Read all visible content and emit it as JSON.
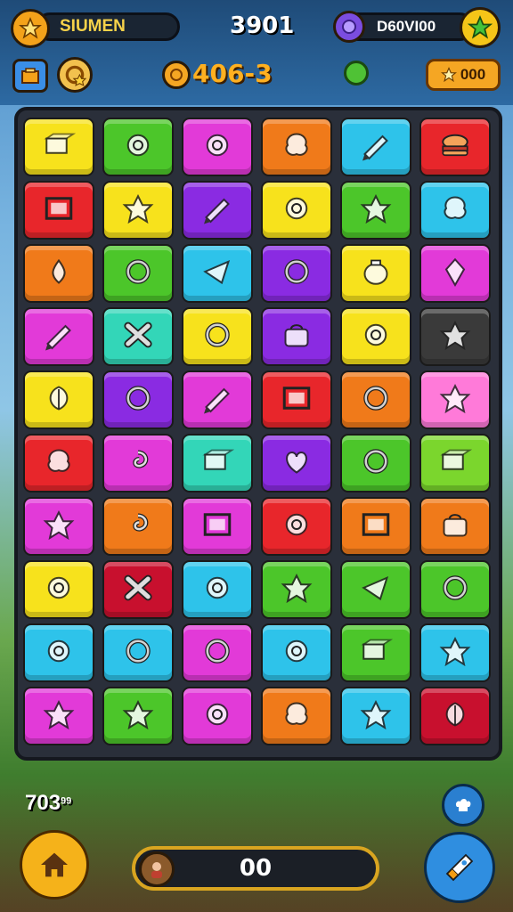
{
  "header": {
    "player_name": "SIUMEN",
    "score": "3901",
    "currency_label": "D60VI00",
    "level_code": "406-3",
    "coin_count": "000"
  },
  "footer": {
    "moves_count": "703",
    "moves_suffix": "99",
    "progress_value": "00"
  },
  "colors": {
    "red": "#e8262b",
    "orange": "#f07a1a",
    "yellow": "#f7e21c",
    "green": "#4cc62a",
    "cyan": "#2ec3ea",
    "purple": "#8a2be2",
    "magenta": "#e23ad8",
    "teal": "#33d6b8",
    "pink": "#ff7ad9",
    "darkgray": "#3a3a3a",
    "lime": "#7bd62d",
    "crimson": "#c8102e"
  },
  "board": {
    "rows": [
      [
        {
          "c": "yellow",
          "i": "box"
        },
        {
          "c": "green",
          "i": "gear"
        },
        {
          "c": "magenta",
          "i": "gear"
        },
        {
          "c": "orange",
          "i": "blob"
        },
        {
          "c": "cyan",
          "i": "pencil"
        },
        {
          "c": "red",
          "i": "burger"
        }
      ],
      [
        {
          "c": "red",
          "i": "frame"
        },
        {
          "c": "yellow",
          "i": "star"
        },
        {
          "c": "purple",
          "i": "pencil"
        },
        {
          "c": "yellow",
          "i": "gear"
        },
        {
          "c": "green",
          "i": "star"
        },
        {
          "c": "cyan",
          "i": "blob"
        }
      ],
      [
        {
          "c": "orange",
          "i": "drop"
        },
        {
          "c": "green",
          "i": "ring"
        },
        {
          "c": "cyan",
          "i": "kite"
        },
        {
          "c": "purple",
          "i": "ring"
        },
        {
          "c": "yellow",
          "i": "jar"
        },
        {
          "c": "magenta",
          "i": "crystal"
        }
      ],
      [
        {
          "c": "magenta",
          "i": "pencil"
        },
        {
          "c": "teal",
          "i": "x"
        },
        {
          "c": "yellow",
          "i": "ring"
        },
        {
          "c": "purple",
          "i": "bag"
        },
        {
          "c": "yellow",
          "i": "gear"
        },
        {
          "c": "darkgray",
          "i": "star"
        }
      ],
      [
        {
          "c": "yellow",
          "i": "leaf"
        },
        {
          "c": "purple",
          "i": "ring"
        },
        {
          "c": "magenta",
          "i": "pencil"
        },
        {
          "c": "red",
          "i": "frame"
        },
        {
          "c": "orange",
          "i": "ring"
        },
        {
          "c": "pink",
          "i": "star"
        }
      ],
      [
        {
          "c": "red",
          "i": "blob"
        },
        {
          "c": "magenta",
          "i": "swirl"
        },
        {
          "c": "teal",
          "i": "box"
        },
        {
          "c": "purple",
          "i": "heart"
        },
        {
          "c": "green",
          "i": "ring"
        },
        {
          "c": "lime",
          "i": "box"
        }
      ],
      [
        {
          "c": "magenta",
          "i": "star"
        },
        {
          "c": "orange",
          "i": "swirl"
        },
        {
          "c": "magenta",
          "i": "frame"
        },
        {
          "c": "red",
          "i": "gear"
        },
        {
          "c": "orange",
          "i": "frame"
        },
        {
          "c": "orange",
          "i": "bag"
        }
      ],
      [
        {
          "c": "yellow",
          "i": "gear"
        },
        {
          "c": "crimson",
          "i": "x"
        },
        {
          "c": "cyan",
          "i": "gear"
        },
        {
          "c": "green",
          "i": "star"
        },
        {
          "c": "green",
          "i": "kite"
        },
        {
          "c": "green",
          "i": "ring"
        }
      ],
      [
        {
          "c": "cyan",
          "i": "gear"
        },
        {
          "c": "cyan",
          "i": "ring"
        },
        {
          "c": "magenta",
          "i": "ring"
        },
        {
          "c": "cyan",
          "i": "gear"
        },
        {
          "c": "green",
          "i": "box"
        },
        {
          "c": "cyan",
          "i": "star"
        }
      ],
      [
        {
          "c": "magenta",
          "i": "star"
        },
        {
          "c": "green",
          "i": "star"
        },
        {
          "c": "magenta",
          "i": "gear"
        },
        {
          "c": "orange",
          "i": "blob"
        },
        {
          "c": "cyan",
          "i": "star"
        },
        {
          "c": "crimson",
          "i": "leaf"
        }
      ]
    ]
  }
}
